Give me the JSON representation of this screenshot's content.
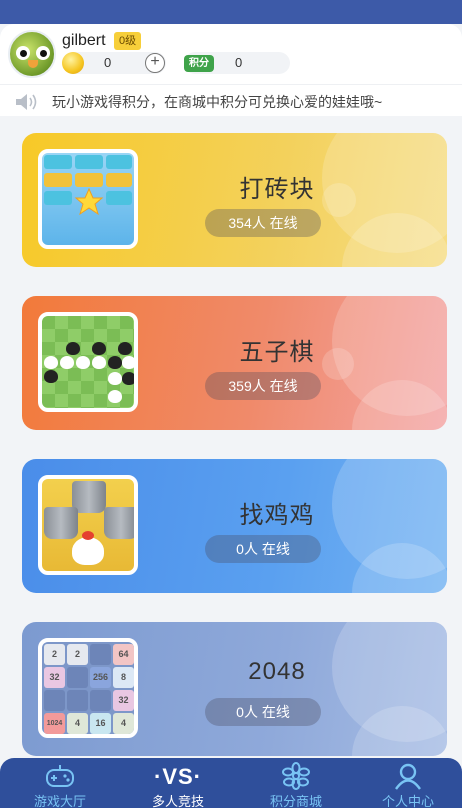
{
  "user": {
    "name": "gilbert",
    "level": "0级",
    "coins": "0",
    "points_label": "积分",
    "points": "0"
  },
  "notice": "玩小游戏得积分，在商城中积分可兑换心爱的娃娃哦~",
  "games": [
    {
      "title": "打砖块",
      "online": "354人 在线"
    },
    {
      "title": "五子棋",
      "online": "359人 在线"
    },
    {
      "title": "找鸡鸡",
      "online": "0人 在线"
    },
    {
      "title": "2048",
      "online": "0人 在线"
    }
  ],
  "tiles_2048": [
    "2",
    "2",
    "",
    "64",
    "32",
    "",
    "256",
    "8",
    "",
    "",
    "",
    "32",
    "1024",
    "4",
    "16",
    "4"
  ],
  "nav": [
    {
      "label": "游戏大厅",
      "icon": "gamepad-icon"
    },
    {
      "label": "多人竞技",
      "icon": "vs-icon",
      "glyph": "·VS·"
    },
    {
      "label": "积分商城",
      "icon": "flower-icon"
    },
    {
      "label": "个人中心",
      "icon": "person-icon"
    }
  ],
  "colors": {
    "header": "#3d5aa8",
    "nav_bg": "#2f4f9b",
    "nav_label": "#79c4f4",
    "level_badge": "#f7cf3a"
  }
}
